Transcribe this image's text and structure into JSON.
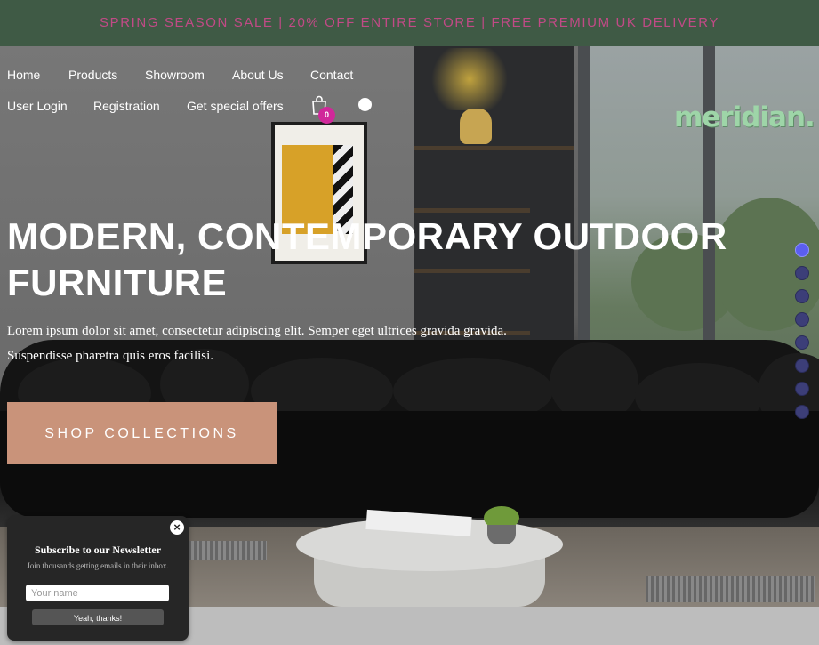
{
  "promo": {
    "text": "SPRING SEASON SALE | 20% OFF ENTIRE STORE | FREE PREMIUM UK DELIVERY"
  },
  "nav": {
    "primary": [
      "Home",
      "Products",
      "Showroom",
      "About Us",
      "Contact"
    ],
    "secondary": [
      "User Login",
      "Registration",
      "Get special offers"
    ],
    "cart_count": "0",
    "cart_icon": "shopping-bag-icon"
  },
  "brand": {
    "logo_text": "meridian.",
    "logo_color": "#9ed5a8"
  },
  "hero": {
    "title_line1": "MODERN, CONTEMPORARY OUTDOOR",
    "title_line2": "FURNITURE",
    "subtitle_line1": "Lorem ipsum dolor sit amet, consectetur adipiscing elit. Semper eget ultrices gravida gravida.",
    "subtitle_line2": "Suspendisse pharetra quis eros facilisi.",
    "cta_label": "SHOP COLLECTIONS",
    "cta_color": "#c9937a",
    "slide_count": 8,
    "active_slide": 1
  },
  "newsletter": {
    "title": "Subscribe to our Newsletter",
    "description": "Join thousands getting emails in their inbox.",
    "input_placeholder": "Your name",
    "submit_label": "Yeah, thanks!",
    "close_icon": "close-icon"
  },
  "colors": {
    "promo_bg": "#3f5a45",
    "promo_text": "#c14a86",
    "badge": "#d0289a",
    "active_dot": "#5b5ef0"
  }
}
